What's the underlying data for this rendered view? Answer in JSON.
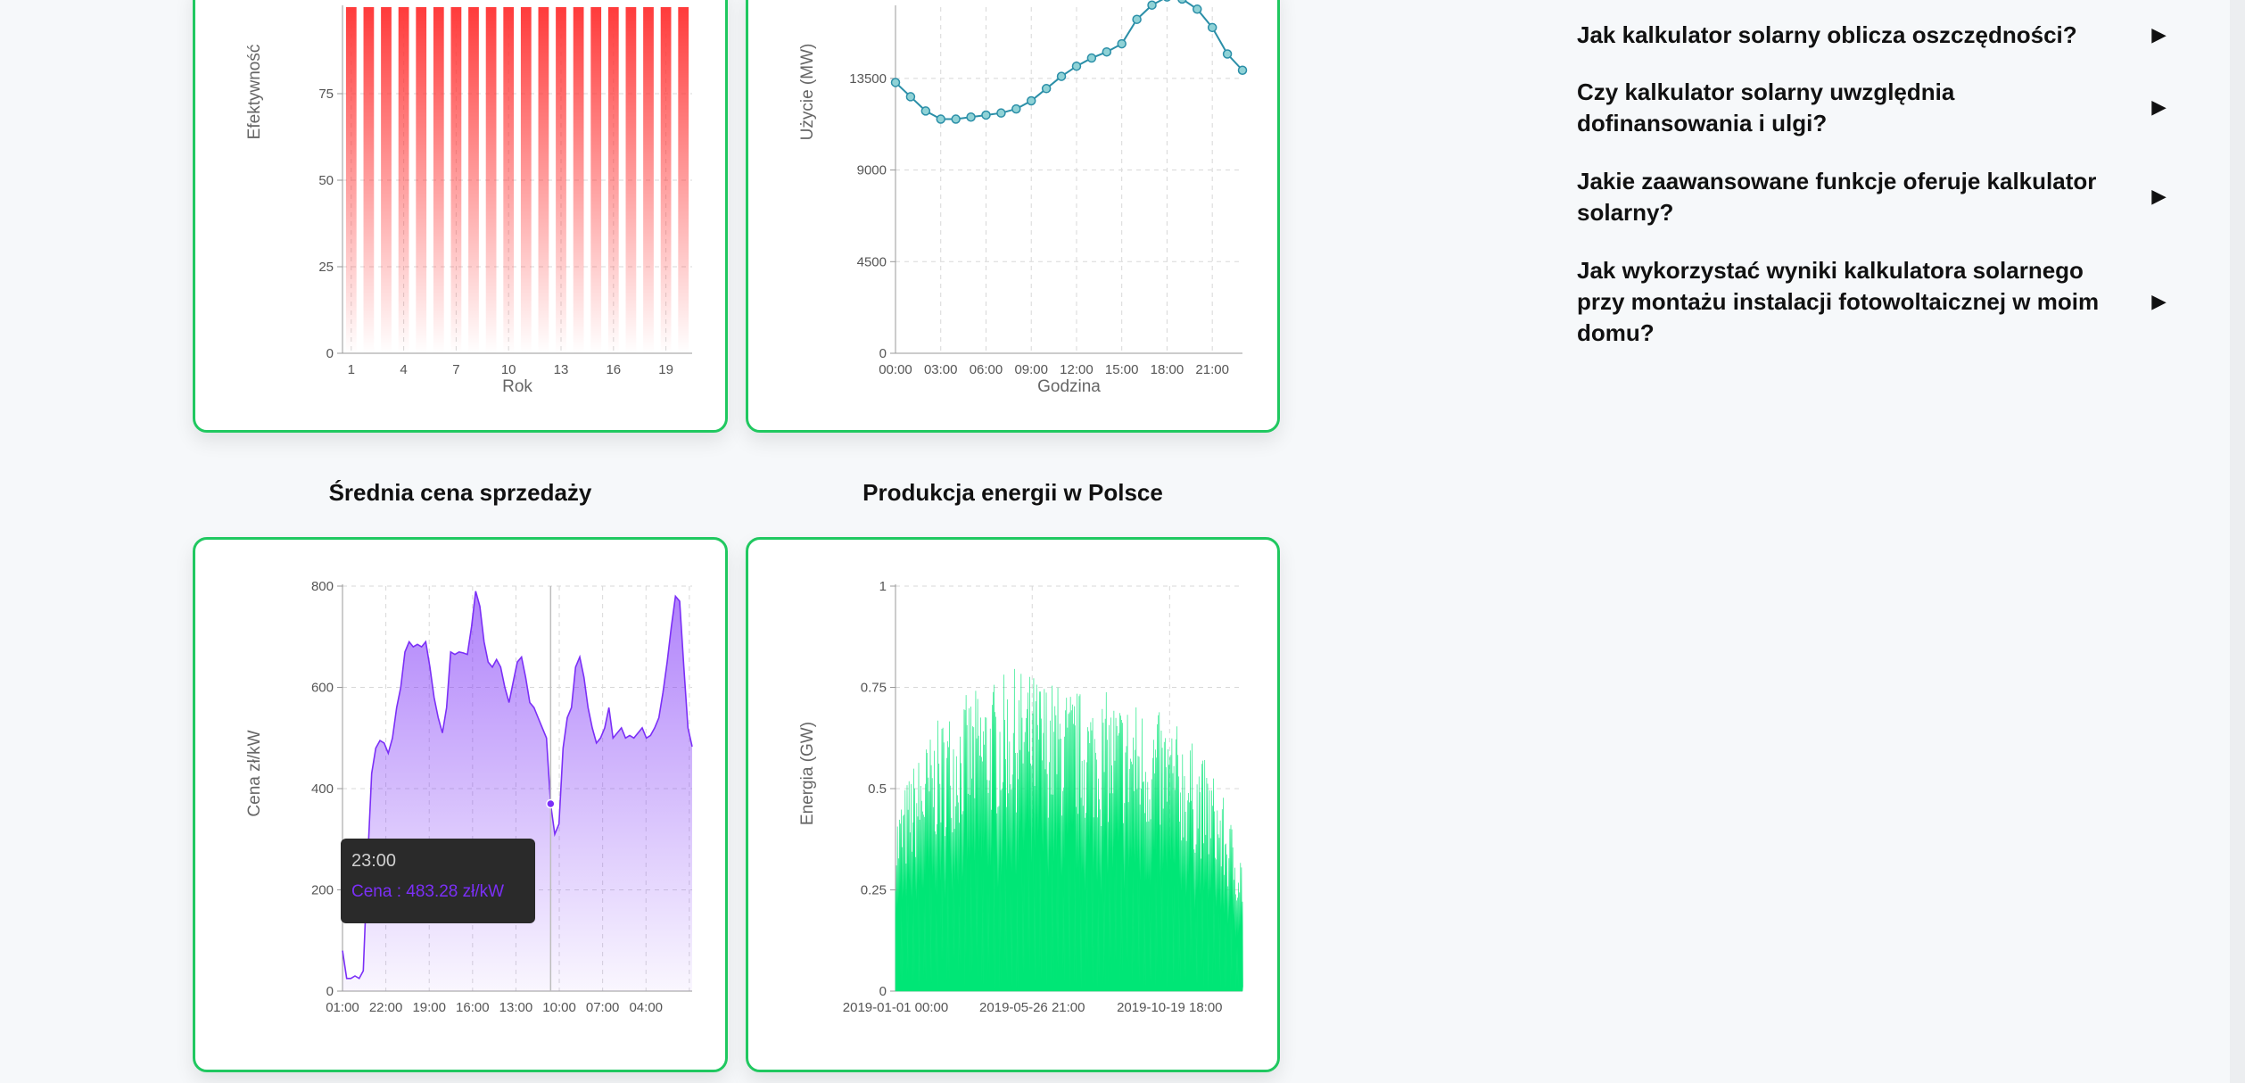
{
  "colors": {
    "card_border": "#20c860",
    "efficiency": "#ff3b3b",
    "usage": "#2b8fa8",
    "price": "#7b2ff7",
    "energy": "#00e676"
  },
  "section_titles": {
    "price": "Średnia cena sprzedaży",
    "energy": "Produkcja energii w Polsce"
  },
  "faq": {
    "arrow_icon": "▶",
    "items": [
      {
        "question": "Jak kalkulator solarny oblicza oszczędności?"
      },
      {
        "question": "Czy kalkulator solarny uwzględnia dofinansowania i ulgi?"
      },
      {
        "question": "Jakie zaawansowane funkcje oferuje kalkulator solarny?"
      },
      {
        "question": "Jak wykorzystać wyniki kalkulatora solarnego przy montażu instalacji fotowoltaicznej w moim domu?"
      }
    ]
  },
  "tooltip": {
    "time": "23:00",
    "value": "Cena : 483.28 zł/kW"
  },
  "chart_data": [
    {
      "type": "bar",
      "ylabel": "Efektywność",
      "xlabel": "Rok",
      "ylim": [
        0,
        100
      ],
      "yticks": [
        0,
        25,
        50,
        75
      ],
      "xticks": [
        "1",
        "4",
        "7",
        "10",
        "13",
        "16",
        "19"
      ],
      "categories": [
        "1",
        "2",
        "3",
        "4",
        "5",
        "6",
        "7",
        "8",
        "9",
        "10",
        "11",
        "12",
        "13",
        "14",
        "15",
        "16",
        "17",
        "18",
        "19",
        "20"
      ],
      "values": [
        100,
        100,
        100,
        100,
        100,
        100,
        100,
        100,
        100,
        100,
        100,
        100,
        100,
        100,
        100,
        100,
        100,
        100,
        100,
        100
      ],
      "grid": true
    },
    {
      "type": "line",
      "ylabel": "Użycie (MW)",
      "xlabel": "Godzina",
      "ylim": [
        0,
        17000
      ],
      "yticks": [
        0,
        4500,
        9000,
        13500
      ],
      "xticks": [
        "00:00",
        "03:00",
        "06:00",
        "09:00",
        "12:00",
        "15:00",
        "18:00",
        "21:00"
      ],
      "x": [
        0,
        1,
        2,
        3,
        4,
        5,
        6,
        7,
        8,
        9,
        10,
        11,
        12,
        13,
        14,
        15,
        16,
        17,
        18,
        19,
        20,
        21,
        22,
        23
      ],
      "values": [
        13300,
        12600,
        11900,
        11500,
        11500,
        11600,
        11700,
        11800,
        12000,
        12400,
        13000,
        13600,
        14100,
        14500,
        14800,
        15200,
        16400,
        17100,
        17500,
        17400,
        16900,
        16000,
        14700,
        13900
      ],
      "grid": true
    },
    {
      "type": "area",
      "ylabel": "Cena zł/kW",
      "ylim": [
        0,
        800
      ],
      "yticks": [
        0,
        200,
        400,
        600,
        800
      ],
      "xticks": [
        "01:00",
        "22:00",
        "19:00",
        "16:00",
        "13:00",
        "10:00",
        "07:00",
        "04:00"
      ],
      "values": [
        80,
        25,
        25,
        30,
        25,
        40,
        250,
        430,
        480,
        495,
        490,
        470,
        500,
        560,
        600,
        670,
        690,
        680,
        685,
        680,
        690,
        640,
        580,
        540,
        510,
        560,
        670,
        665,
        670,
        668,
        665,
        720,
        790,
        760,
        690,
        650,
        640,
        655,
        640,
        600,
        570,
        610,
        650,
        660,
        620,
        570,
        560,
        540,
        520,
        500,
        370,
        310,
        330,
        480,
        540,
        560,
        640,
        660,
        620,
        560,
        520,
        490,
        500,
        520,
        560,
        500,
        510,
        520,
        500,
        505,
        500,
        510,
        520,
        500,
        505,
        520,
        540,
        590,
        650,
        720,
        780,
        770,
        640,
        520,
        483
      ],
      "highlight_index": 50,
      "grid": true
    },
    {
      "type": "area",
      "ylabel": "Energia (GW)",
      "ylim": [
        0,
        1
      ],
      "yticks": [
        0,
        0.25,
        0.5,
        0.75,
        1
      ],
      "xticks": [
        "2019-01-01 00:00",
        "2019-05-26 21:00",
        "2019-10-19 18:00"
      ],
      "envelope": [
        0.45,
        0.55,
        0.62,
        0.68,
        0.72,
        0.74,
        0.76,
        0.78,
        0.8,
        0.79,
        0.78,
        0.76,
        0.75,
        0.74,
        0.74,
        0.73,
        0.72,
        0.7,
        0.68,
        0.65,
        0.6,
        0.55,
        0.45,
        0.35
      ],
      "grid": true
    }
  ]
}
